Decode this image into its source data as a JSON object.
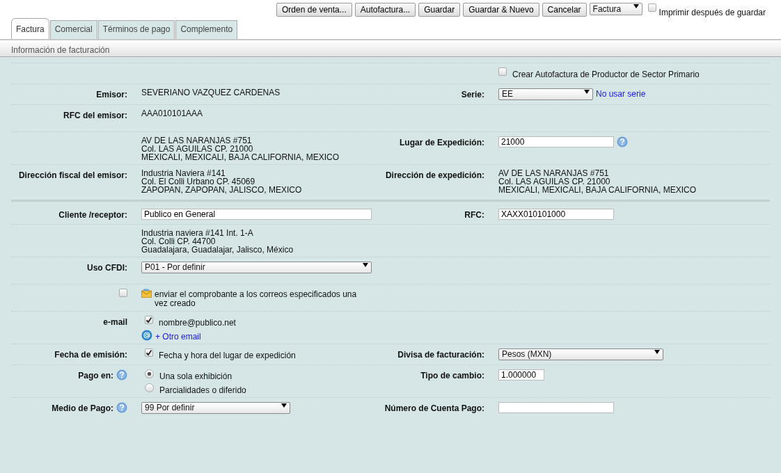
{
  "toolbar": {
    "buttons": [
      "Orden de venta...",
      "Autofactura...",
      "Guardar",
      "Guardar & Nuevo",
      "Cancelar"
    ],
    "document_type": "Factura",
    "print_after_save": {
      "label": "Imprimir después de guardar",
      "checked": false
    }
  },
  "tabs": [
    {
      "label": "Factura",
      "selected": true
    },
    {
      "label": "Comercial",
      "selected": false
    },
    {
      "label": "Términos de pago",
      "selected": false
    },
    {
      "label": "Complemento",
      "selected": false
    }
  ],
  "section_title": "Información de facturación",
  "rows": [
    {
      "content2": [
        {
          "kind": "checkbox",
          "label": "Crear Autofactura de Productor de Sector Primario",
          "checked": false
        }
      ]
    },
    {
      "label": "Emisor:",
      "content": [
        {
          "kind": "text",
          "lines": [
            "SEVERIANO VAZQUEZ CARDENAS"
          ]
        }
      ],
      "label2": "Serie:",
      "content2": [
        {
          "kind": "select",
          "value": "EE"
        },
        {
          "kind": "link",
          "text": "No usar serie"
        }
      ]
    },
    {
      "label": "RFC del emisor:",
      "content": [
        {
          "kind": "text",
          "lines": [
            "AAA010101AAA"
          ]
        }
      ]
    },
    {
      "content": [
        {
          "kind": "text",
          "lines": [
            "AV DE LAS NARANJAS #751",
            "Col. LAS AGUILAS CP. 21000",
            "MEXICALI, MEXICALI, BAJA CALIFORNIA, MEXICO"
          ]
        }
      ],
      "label2": "Lugar de Expedición:",
      "content2": [
        {
          "kind": "input",
          "value": "21000"
        },
        {
          "kind": "help"
        }
      ]
    },
    {
      "label": "Dirección fiscal del emisor:",
      "content": [
        {
          "kind": "text",
          "lines": [
            "Industria Naviera #141",
            "Col. El Colli Urbano CP. 45069",
            "ZAPOPAN, ZAPOPAN, JALISCO, MEXICO"
          ]
        }
      ],
      "label2": "Dirección de expedición:",
      "content2": [
        {
          "kind": "text",
          "lines": [
            "AV DE LAS NARANJAS #751",
            "Col. LAS AGUILAS CP. 21000",
            "MEXICALI, MEXICALI, BAJA CALIFORNIA, MEXICO"
          ]
        }
      ]
    },
    {
      "section_start": true,
      "label": "Cliente /receptor:",
      "content": [
        {
          "kind": "input",
          "value": "Publico en General"
        }
      ],
      "label2": "RFC:",
      "content2": [
        {
          "kind": "input",
          "value": "XAXX010101000"
        }
      ]
    },
    {
      "content": [
        {
          "kind": "text",
          "lines": [
            "Industria naviera #141 Int. 1-A",
            "Col. Colli CP. 44700",
            "Guadalajara, Guadalajar, Jalisco, México"
          ]
        }
      ]
    },
    {
      "label": "Uso CFDI:",
      "content": [
        {
          "kind": "select",
          "value": "P01 - Por definir"
        }
      ]
    },
    {
      "label_checkbox": {
        "checked": false
      },
      "content": [
        {
          "kind": "notice",
          "text": "enviar el comprobante a los correos especificados una vez creado"
        }
      ]
    },
    {
      "label": "e-mail",
      "content": [
        {
          "kind": "checkbox",
          "label": "nombre@publico.net",
          "checked": true
        },
        {
          "kind": "add_link",
          "text": "+ Otro email"
        }
      ]
    },
    {
      "label": "Fecha de emisión:",
      "content": [
        {
          "kind": "checkbox",
          "label": "Fecha y hora del lugar de expedición",
          "checked": true
        }
      ],
      "label2": "Divisa de facturación:",
      "content2": [
        {
          "kind": "select",
          "value": "Pesos (MXN)"
        }
      ]
    },
    {
      "label": "Pago en:",
      "label_help": true,
      "content": [
        {
          "kind": "radio",
          "label": "Una sola exhibición",
          "selected": true
        },
        {
          "kind": "radio",
          "label": "Parcialidades o diferido",
          "selected": false
        }
      ],
      "label2": "Tipo de cambio:",
      "content2": [
        {
          "kind": "input",
          "value": "1.000000"
        }
      ]
    },
    {
      "label": "Medio de Pago:",
      "label_help": true,
      "content": [
        {
          "kind": "select",
          "value": "99 Por definir"
        }
      ],
      "label2": "Número de Cuenta Pago:",
      "content2": [
        {
          "kind": "input"
        }
      ]
    }
  ]
}
